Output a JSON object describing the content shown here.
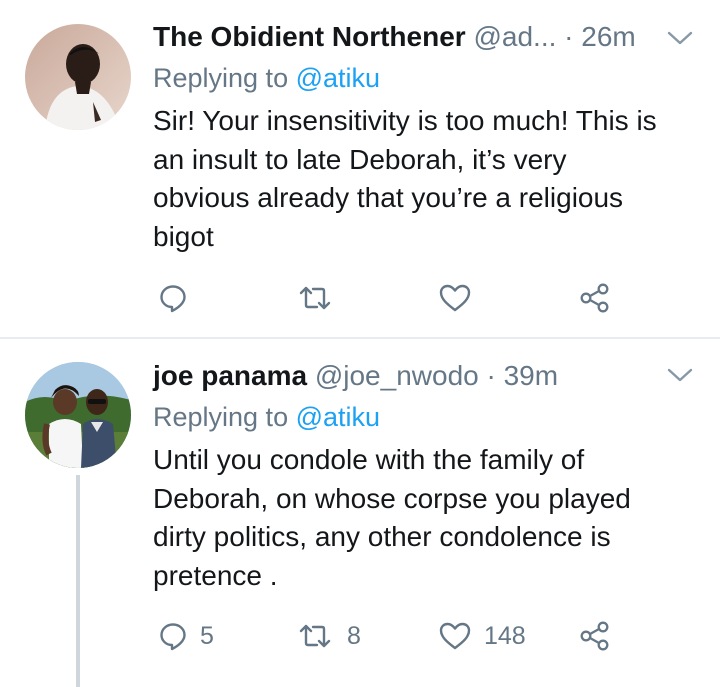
{
  "tweets": [
    {
      "author_name": "The Obidient Northener",
      "author_handle": "@ad...",
      "time": "· 26m",
      "replying_label": "Replying to",
      "replying_to": "@atiku",
      "text": "Sir! Your insensitivity is too much! This is\nan insult to late Deborah, it’s very\nobvious already that you’re a religious\nbigot",
      "replies": "",
      "retweets": "",
      "likes": "",
      "icons": [
        "reply-icon",
        "retweet-icon",
        "like-icon",
        "share-icon",
        "chevron-down-icon"
      ]
    },
    {
      "author_name": "joe panama",
      "author_handle": "@joe_nwodo",
      "time": "· 39m",
      "replying_label": "Replying to",
      "replying_to": "@atiku",
      "text": "Until you condole with the family of\nDeborah, on whose corpse you played\ndirty politics, any other condolence is\npretence .",
      "replies": "5",
      "retweets": "8",
      "likes": "148",
      "icons": [
        "reply-icon",
        "retweet-icon",
        "like-icon",
        "share-icon",
        "chevron-down-icon"
      ]
    }
  ],
  "colors": {
    "text": "#14171a",
    "secondary": "#657786",
    "link": "#1da1f2",
    "divider": "#e6ecf0",
    "thread_line": "#cfd6dc"
  }
}
